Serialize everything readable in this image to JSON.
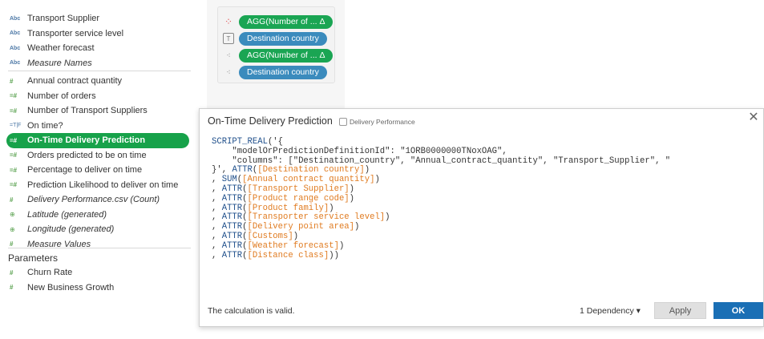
{
  "data_pane": {
    "fields": [
      {
        "icon": "Abc",
        "name": "Transport Supplier",
        "kind": "dim"
      },
      {
        "icon": "Abc",
        "name": "Transporter service level",
        "kind": "dim"
      },
      {
        "icon": "Abc",
        "name": "Weather forecast",
        "kind": "dim"
      },
      {
        "icon": "Abc",
        "name": "Measure Names",
        "kind": "dim"
      },
      {
        "icon": "#",
        "name": "Annual contract quantity",
        "kind": "meas"
      },
      {
        "icon": "=#",
        "name": "Number of orders",
        "kind": "meas"
      },
      {
        "icon": "=#",
        "name": "Number of Transport Suppliers",
        "kind": "meas"
      },
      {
        "icon": "=T|F",
        "name": "On time?",
        "kind": "bool"
      },
      {
        "icon": "=#",
        "name": "On-Time Delivery Prediction",
        "kind": "meas"
      },
      {
        "icon": "=#",
        "name": "Orders predicted to be on time",
        "kind": "meas"
      },
      {
        "icon": "=#",
        "name": "Percentage to deliver on time",
        "kind": "meas"
      },
      {
        "icon": "=#",
        "name": "Prediction Likelihood to deliver on time",
        "kind": "meas"
      },
      {
        "icon": "#",
        "name": "Delivery Performance.csv (Count)",
        "kind": "meas"
      },
      {
        "icon": "⊕",
        "name": "Latitude (generated)",
        "kind": "geo"
      },
      {
        "icon": "⊕",
        "name": "Longitude (generated)",
        "kind": "geo"
      },
      {
        "icon": "#",
        "name": "Measure Values",
        "kind": "meas"
      }
    ],
    "parameters_header": "Parameters",
    "parameters": [
      {
        "icon": "#",
        "name": "Churn Rate"
      },
      {
        "icon": "#",
        "name": "New Business Growth"
      }
    ]
  },
  "marks": [
    {
      "icon": "color-icon",
      "glyph": "⁘",
      "label": "AGG(Number of ... Δ",
      "color": "green"
    },
    {
      "icon": "text-icon",
      "glyph": "T",
      "label": "Destination country",
      "color": "blue"
    },
    {
      "icon": "detail-icon",
      "glyph": "⁖",
      "label": "AGG(Number of ... Δ",
      "color": "green"
    },
    {
      "icon": "detail-icon",
      "glyph": "⁖",
      "label": "Destination country",
      "color": "blue"
    }
  ],
  "dialog": {
    "title": "On-Time Delivery Prediction",
    "data_source": "Delivery Performance",
    "close": "✕",
    "code_lines": [
      "SCRIPT_REAL('{",
      "    \"modelOrPredictionDefinitionId\": \"1ORB0000000TNoxOAG\",",
      "    \"columns\": [\"Destination_country\", \"Annual_contract_quantity\", \"Transport_Supplier\", \"",
      "}', ATTR([Destination country])",
      ", SUM([Annual contract quantity])",
      ", ATTR([Transport Supplier])",
      ", ATTR([Product range code])",
      ", ATTR([Product family])",
      ", ATTR([Transporter service level])",
      ", ATTR([Delivery point area])",
      ", ATTR([Customs])",
      ", ATTR([Weather forecast])",
      ", ATTR([Distance class]))"
    ],
    "status": "The calculation is valid.",
    "dependency": "1 Dependency ▾",
    "apply_label": "Apply",
    "ok_label": "OK"
  }
}
